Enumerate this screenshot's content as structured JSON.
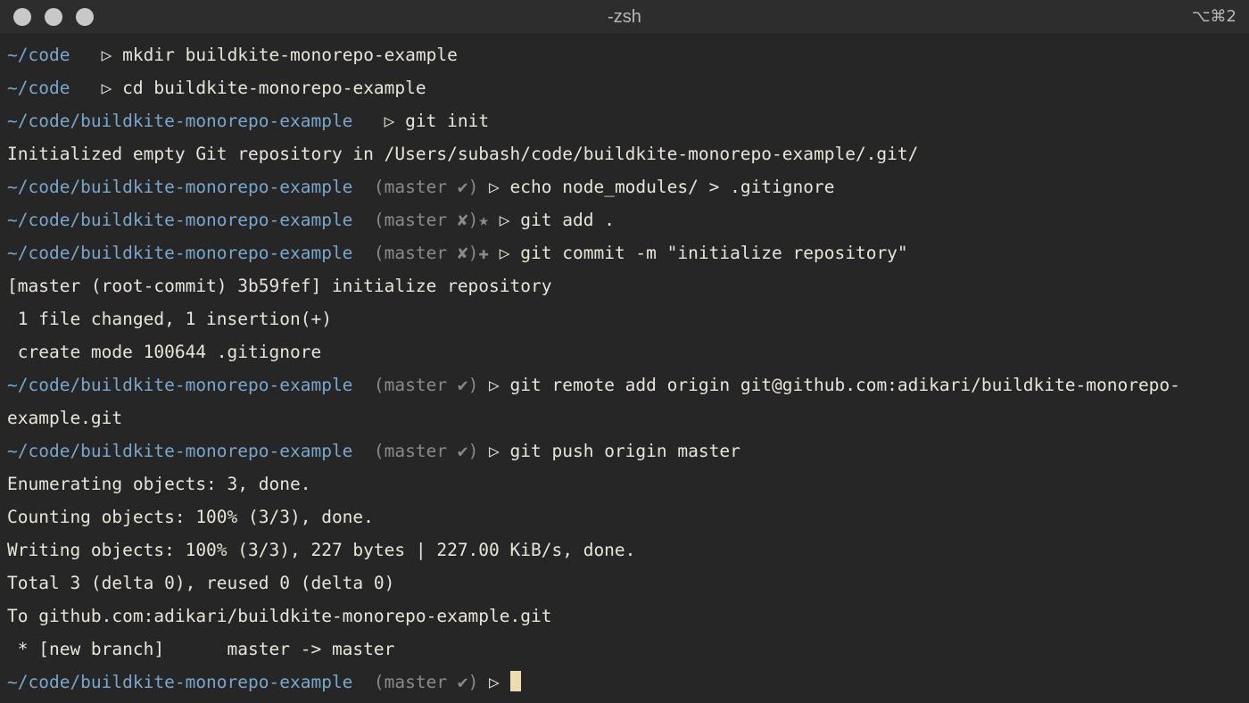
{
  "window": {
    "title": "-zsh",
    "shortcut": "⌥⌘2"
  },
  "colors": {
    "background": "#262626",
    "titlebar": "#2d2d2d",
    "path": "#79a7cc",
    "git_status": "#8a8a8a",
    "text": "#e6e6d8",
    "cursor": "#ecdcb0"
  },
  "terminal": {
    "lines": [
      {
        "kind": "prompt",
        "path": "~/code",
        "git": "",
        "arrow": " ▷ ",
        "cmd": "mkdir buildkite-monorepo-example"
      },
      {
        "kind": "prompt",
        "path": "~/code",
        "git": "",
        "arrow": " ▷ ",
        "cmd": "cd buildkite-monorepo-example"
      },
      {
        "kind": "prompt",
        "path": "~/code/buildkite-monorepo-example",
        "git": "",
        "arrow": " ▷ ",
        "cmd": "git init"
      },
      {
        "kind": "output",
        "text": "Initialized empty Git repository in /Users/subash/code/buildkite-monorepo-example/.git/"
      },
      {
        "kind": "prompt",
        "path": "~/code/buildkite-monorepo-example",
        "git": "(master ✔)",
        "arrow": " ▷ ",
        "cmd": "echo node_modules/ > .gitignore"
      },
      {
        "kind": "prompt",
        "path": "~/code/buildkite-monorepo-example",
        "git": "(master ✘)★",
        "arrow": " ▷ ",
        "cmd": "git add ."
      },
      {
        "kind": "prompt",
        "path": "~/code/buildkite-monorepo-example",
        "git": "(master ✘)✚",
        "arrow": " ▷ ",
        "cmd": "git commit -m \"initialize repository\""
      },
      {
        "kind": "output",
        "text": "[master (root-commit) 3b59fef] initialize repository"
      },
      {
        "kind": "output",
        "text": " 1 file changed, 1 insertion(+)"
      },
      {
        "kind": "output",
        "text": " create mode 100644 .gitignore"
      },
      {
        "kind": "prompt",
        "path": "~/code/buildkite-monorepo-example",
        "git": "(master ✔)",
        "arrow": " ▷ ",
        "cmd": "git remote add origin git@github.com:adikari/buildkite-monorepo-"
      },
      {
        "kind": "output",
        "text": "example.git"
      },
      {
        "kind": "prompt",
        "path": "~/code/buildkite-monorepo-example",
        "git": "(master ✔)",
        "arrow": " ▷ ",
        "cmd": "git push origin master"
      },
      {
        "kind": "output",
        "text": "Enumerating objects: 3, done."
      },
      {
        "kind": "output",
        "text": "Counting objects: 100% (3/3), done."
      },
      {
        "kind": "output",
        "text": "Writing objects: 100% (3/3), 227 bytes | 227.00 KiB/s, done."
      },
      {
        "kind": "output",
        "text": "Total 3 (delta 0), reused 0 (delta 0)"
      },
      {
        "kind": "output",
        "text": "To github.com:adikari/buildkite-monorepo-example.git"
      },
      {
        "kind": "output",
        "text": " * [new branch]      master -> master"
      },
      {
        "kind": "prompt",
        "path": "~/code/buildkite-monorepo-example",
        "git": "(master ✔)",
        "arrow": " ▷ ",
        "cmd": "",
        "cursor": true
      }
    ]
  }
}
